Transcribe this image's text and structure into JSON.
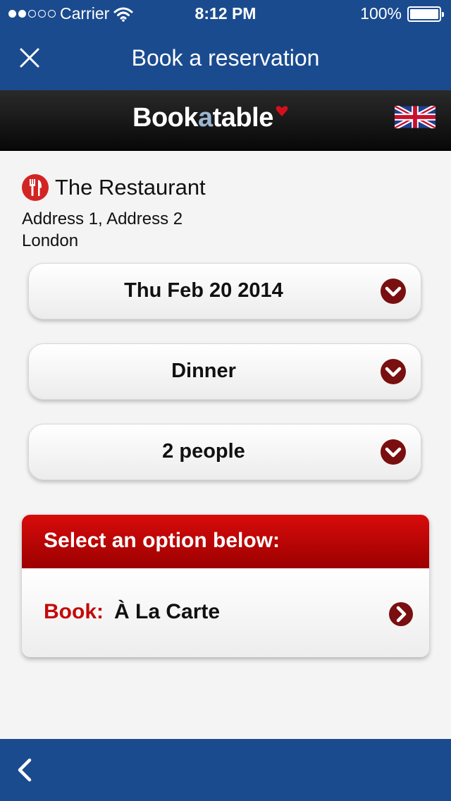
{
  "status": {
    "carrier": "Carrier",
    "time": "8:12 PM",
    "battery": "100%",
    "signal_bars": 2,
    "battery_level": 1.0
  },
  "nav": {
    "title": "Book a reservation"
  },
  "brand": {
    "prefix": "Book",
    "middle": "a",
    "suffix": "table"
  },
  "restaurant": {
    "name": "The Restaurant",
    "address_line1": "Address 1, Address 2",
    "address_line2": "London"
  },
  "selectors": {
    "date": "Thu Feb 20 2014",
    "meal": "Dinner",
    "party": "2 people"
  },
  "options": {
    "header": "Select an option below:",
    "book_label": "Book:",
    "book_name": "À La Carte"
  },
  "colors": {
    "nav_blue": "#1b4b8f",
    "accent_red": "#c40a0a",
    "chevron_maroon": "#7a0f0f"
  }
}
